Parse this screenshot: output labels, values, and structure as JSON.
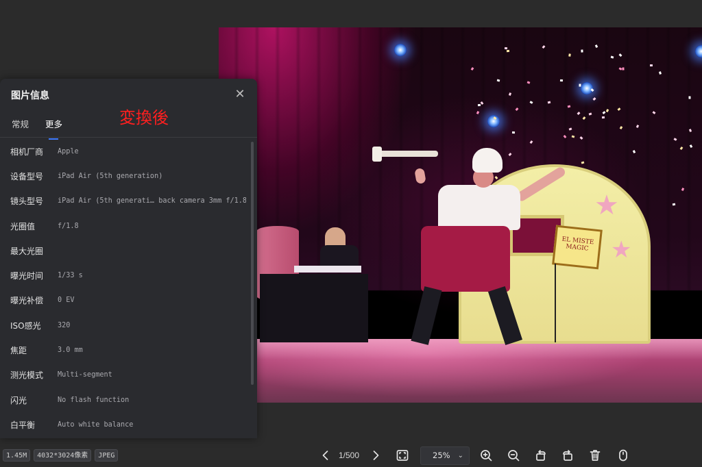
{
  "info_panel": {
    "title": "图片信息",
    "close_icon": "close-icon",
    "tabs": [
      {
        "label": "常规",
        "active": false
      },
      {
        "label": "更多",
        "active": true
      }
    ],
    "overlay_label": "変換後",
    "rows": [
      {
        "key": "相机厂商",
        "value": "Apple"
      },
      {
        "key": "设备型号",
        "value": "iPad Air (5th generation)"
      },
      {
        "key": "镜头型号",
        "value": "iPad Air (5th generati… back camera 3mm f/1.8"
      },
      {
        "key": "光圈值",
        "value": "f/1.8"
      },
      {
        "key": "最大光圈",
        "value": ""
      },
      {
        "key": "曝光时间",
        "value": "1/33 s"
      },
      {
        "key": "曝光补偿",
        "value": "0 EV"
      },
      {
        "key": "ISO感光",
        "value": "320"
      },
      {
        "key": "焦距",
        "value": "3.0 mm"
      },
      {
        "key": "测光模式",
        "value": "Multi-segment"
      },
      {
        "key": "闪光",
        "value": "No flash function"
      },
      {
        "key": "白平衡",
        "value": "Auto white balance"
      }
    ]
  },
  "status_bar": {
    "file_size": "1.45M",
    "dimensions": "4032*3024像素",
    "format": "JPEG"
  },
  "toolbar": {
    "page_count": "1/500",
    "zoom_level": "25%",
    "icons": [
      "chevron-left-icon",
      "chevron-right-icon",
      "fit-screen-icon",
      "chevron-down-icon",
      "zoom-in-icon",
      "zoom-out-icon",
      "rotate-left-icon",
      "rotate-right-icon",
      "delete-icon",
      "mouse-icon"
    ]
  },
  "photo": {
    "sign_text": "EL MISTE MAGIC",
    "description_icon": "photo-image"
  },
  "colors": {
    "panel_bg": "#2a2b2f",
    "tab_accent": "#3f7bff",
    "overlay_label": "#ff1f1f",
    "app_bg": "#2b2b2b"
  }
}
